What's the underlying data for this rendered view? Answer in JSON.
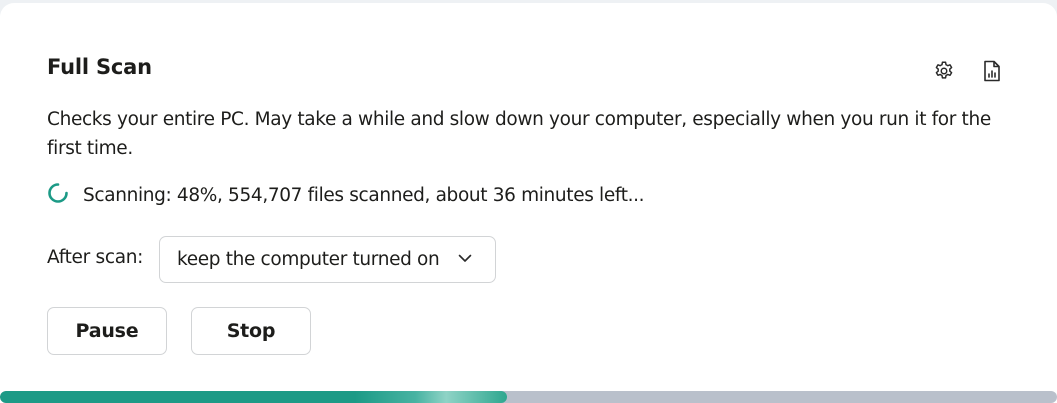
{
  "card": {
    "title": "Full Scan",
    "description": "Checks your entire PC. May take a while and slow down your computer, especially when you run it for the first time.",
    "status": "Scanning: 48%, 554,707 files scanned, about 36 minutes left...",
    "after_scan": {
      "label": "After scan:",
      "selected": "keep the computer turned on"
    },
    "buttons": {
      "pause": "Pause",
      "stop": "Stop"
    },
    "progress_percent": 48,
    "icons": {
      "settings": "gear-icon",
      "report": "report-icon",
      "spinner": "loading-spinner-icon",
      "dropdown": "chevron-down-icon"
    }
  },
  "colors": {
    "accent": "#1c9a86",
    "progress_track": "#b9c0cb",
    "border": "#d2d4d6",
    "text": "#1d1d1b"
  }
}
